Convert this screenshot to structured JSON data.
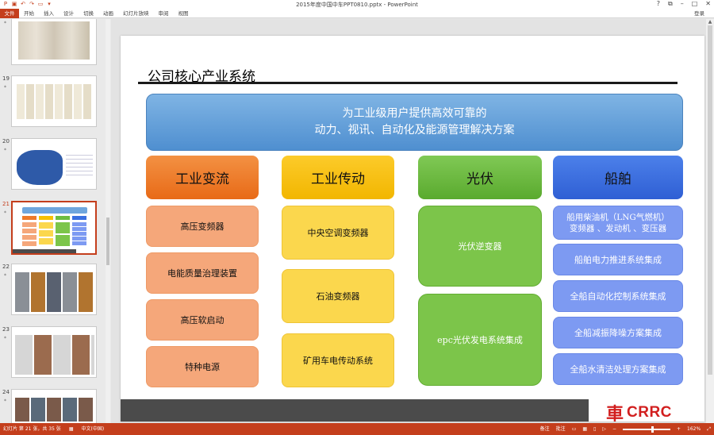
{
  "window": {
    "title": "2015年度中国中车PPT0810.pptx - PowerPoint",
    "help": "?",
    "controls": [
      "–",
      "□",
      "✕"
    ],
    "ribbon_mode": "⧉"
  },
  "ribbon": {
    "file_label": "文件",
    "tabs": [
      "开始",
      "插入",
      "设计",
      "切换",
      "动画",
      "幻灯片放映",
      "审阅",
      "视图"
    ],
    "login": "登录"
  },
  "thumbnails": [
    {
      "num": "",
      "star": "*",
      "kind": "products"
    },
    {
      "num": "19",
      "star": "*",
      "kind": "certificates"
    },
    {
      "num": "20",
      "star": "*",
      "kind": "map"
    },
    {
      "num": "21",
      "star": "*",
      "kind": "current"
    },
    {
      "num": "22",
      "star": "*",
      "kind": "photos"
    },
    {
      "num": "23",
      "star": "*",
      "kind": "photos2"
    },
    {
      "num": "24",
      "star": "*",
      "kind": "photos3"
    }
  ],
  "slide": {
    "title": "公司核心产业系统",
    "banner_line1": "为工业级用户提供高效可靠的",
    "banner_line2": "动力、视讯、自动化及能源管理解决方案",
    "columns": [
      {
        "header": "工业变流",
        "items": [
          "高压变频器",
          "电能质量治理装置",
          "高压软启动",
          "特种电源"
        ]
      },
      {
        "header": "工业传动",
        "items": [
          "中央空调变频器",
          "石油变频器",
          "矿用车电传动系统"
        ]
      },
      {
        "header": "光伏",
        "items": [
          "光伏逆变器",
          "epc光伏发电系统集成"
        ]
      },
      {
        "header": "船舶",
        "items": [
          "船用柴油机（LNG气燃机）\n变频器 、发动机 、变压器",
          "船舶电力推进系统集成",
          "全船自动化控制系统集成",
          "全船减振降噪方案集成",
          "全船水清洁处理方案集成"
        ]
      }
    ],
    "logo_mark": "車",
    "logo_text": "CRRC"
  },
  "status": {
    "slide_info": "幻灯片 第 21 张，共 35 张",
    "language": "中文(中国)",
    "notes": "备注",
    "comments": "批注",
    "zoom": "162%"
  },
  "colors": {
    "accent": "#c43e1c",
    "col1_head": "#ee7a2a",
    "col1_item": "#f5a77a",
    "col2_head": "#f7c100",
    "col2_item": "#fbd74d",
    "col3_head": "#6cbd3f",
    "col3_item": "#7cc54a",
    "col4_head": "#3a6fe0",
    "col4_item": "#7d9af2"
  }
}
